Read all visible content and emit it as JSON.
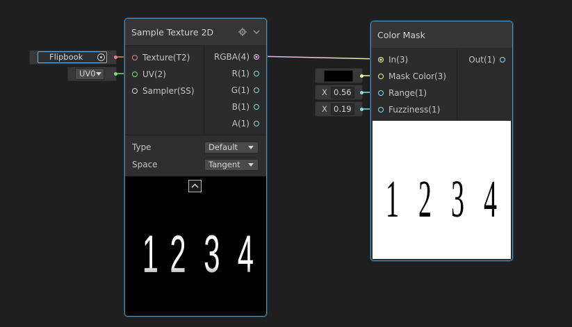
{
  "graph": {
    "wire_color_uv": "#7de07d",
    "wire_color_texture": "#f08080",
    "wire_color_rgba": "#ffffff",
    "wire_color_mask": "#f4f4a0",
    "wire_color_float": "#84e4e7"
  },
  "inline_inputs": {
    "texture_value": "Flipbook",
    "uv_value": "UV0",
    "range_label": "X",
    "range_value": "0.56",
    "fuzziness_label": "X",
    "fuzziness_value": "0.19",
    "mask_color": "#000000"
  },
  "sample_texture_node": {
    "title": "Sample Texture 2D",
    "inputs": [
      "Texture(T2)",
      "UV(2)",
      "Sampler(SS)"
    ],
    "outputs": [
      "RGBA(4)",
      "R(1)",
      "G(1)",
      "B(1)",
      "A(1)"
    ],
    "settings": [
      {
        "label": "Type",
        "value": "Default"
      },
      {
        "label": "Space",
        "value": "Tangent"
      }
    ],
    "preview_digits": [
      "1",
      "2",
      "3",
      "4"
    ]
  },
  "color_mask_node": {
    "title": "Color Mask",
    "inputs": [
      "In(3)",
      "Mask Color(3)",
      "Range(1)",
      "Fuzziness(1)"
    ],
    "outputs": [
      "Out(1)"
    ],
    "preview_digits": [
      "1",
      "2",
      "3",
      "4"
    ]
  }
}
